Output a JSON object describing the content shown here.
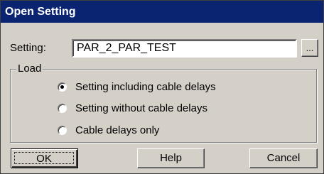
{
  "window": {
    "title": "Open Setting"
  },
  "setting": {
    "label": "Setting:",
    "value": "PAR_2_PAR_TEST",
    "browse_label": "..."
  },
  "load_group": {
    "legend": "Load",
    "options": [
      {
        "label": "Setting including cable delays",
        "selected": true
      },
      {
        "label": "Setting without cable delays",
        "selected": false
      },
      {
        "label": "Cable delays only",
        "selected": false
      }
    ]
  },
  "buttons": {
    "ok_label": "OK",
    "help_label": "Help",
    "cancel_label": "Cancel"
  },
  "colors": {
    "titlebar": "#0a2472",
    "face": "#d4d0c8"
  }
}
